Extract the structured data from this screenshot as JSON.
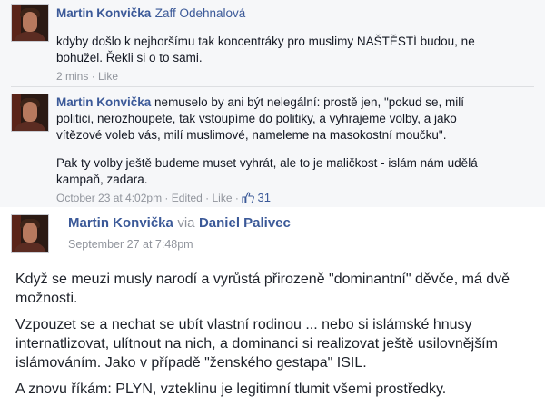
{
  "comments": [
    {
      "author": "Martin Konvička",
      "tagged": "Zaff Odehnalová",
      "text_lines": [
        "kdyby došlo k nejhoršímu tak koncentráky pro muslimy NAŠTĚSTÍ budou, ne",
        "bohužel. Řekli si o to sami."
      ],
      "time": "2 mins",
      "like_label": "Like"
    },
    {
      "author": "Martin Konvička",
      "text_lines": [
        "nemuselo by ani být nelegální: prostě jen, \"pokud se, milí",
        "politici, nerozhoupete, tak vstoupíme do politiky, a vyhrajeme volby, a jako",
        "vítězové voleb vás, milí muslimové, nameleme na masokostní moučku\"."
      ],
      "text2_lines": [
        "Pak ty volby ještě budeme muset vyhrát, ale to je maličkost - islám nám udělá",
        "kampaň, zadara."
      ],
      "time": "October 23 at 4:02pm",
      "edited": "Edited",
      "like_label": "Like",
      "like_count": "31"
    }
  ],
  "post": {
    "author": "Martin Konvička",
    "via": "via",
    "page": "Daniel Palivec",
    "time": "September 27 at 7:48pm",
    "paragraphs": [
      [
        "Když se meuzi musly narodí a vyrůstá přirozeně \"dominantní\" děvče, má dvě",
        "možnosti."
      ],
      [
        "Vzpouzet se a nechat se ubít vlastní rodinou ... nebo si islámské hnusy",
        "internatlizovat, ulítnout na nich, a dominanci si realizovat ještě usilovnějším",
        "islámováním. Jako v případě \"ženského gestapa\" ISIL."
      ],
      [
        "A znovu říkám: PLYN, vzteklinu je legitimní tlumit všemi prostředky."
      ]
    ]
  },
  "colors": {
    "link": "#3b5998",
    "meta": "#90949c",
    "panel": "#f6f7f9"
  }
}
